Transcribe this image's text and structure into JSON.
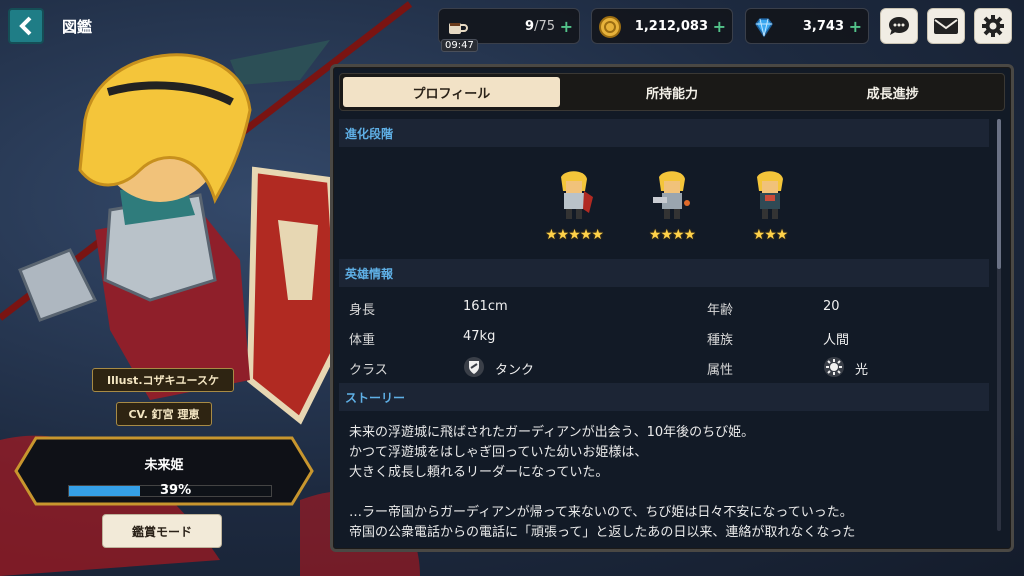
{
  "header": {
    "title": "図鑑",
    "stamina": {
      "current": "9",
      "max": "/75",
      "timer": "09:47",
      "icon": "coffee-cup-icon"
    },
    "gold": {
      "value": "1,212,083",
      "icon": "gold-coin-icon"
    },
    "gems": {
      "value": "3,743",
      "icon": "diamond-icon"
    },
    "plus": "+",
    "buttons": [
      "chat-icon",
      "mail-icon",
      "gear-icon"
    ]
  },
  "tabs": [
    "プロフィール",
    "所持能力",
    "成長進捗"
  ],
  "sections": {
    "evolution": "進化段階",
    "hero_info": "英雄情報",
    "story": "ストーリー"
  },
  "evolution_stages": [
    {
      "stars": "★★★★★",
      "star_count": 5
    },
    {
      "stars": "★★★★",
      "star_count": 4
    },
    {
      "stars": "★★★",
      "star_count": 3
    }
  ],
  "hero_info": {
    "height_label": "身長",
    "height": "161cm",
    "age_label": "年齢",
    "age": "20",
    "weight_label": "体重",
    "weight": "47kg",
    "race_label": "種族",
    "race": "人間",
    "class_label": "クラス",
    "class": "タンク",
    "element_label": "属性",
    "element": "光"
  },
  "story": [
    "未来の浮遊城に飛ばされたガーディアンが出会う、10年後のちび姫。",
    "かつて浮遊城をはしゃぎ回っていた幼いお姫様は、",
    "大きく成長し頼れるリーダーになっていた。",
    "",
    "…ラー帝国からガーディアンが帰って来ないので、ちび姫は日々不安になっていった。",
    "帝国の公衆電話からの電話に「頑張って」と返したあの日以来、連絡が取れなくなった"
  ],
  "hero": {
    "illustrator": "Illust.コザキユースケ",
    "voice": "CV. 釘宮 理恵",
    "name": "未来姫",
    "progress_percent": 39,
    "progress_label": "39%",
    "view_mode_button": "鑑賞モード"
  },
  "colors": {
    "accent_blue": "#5fb0e6",
    "star": "#ffd24a",
    "tab_active": "#f2e2c6",
    "plus_green": "#53c38a"
  }
}
